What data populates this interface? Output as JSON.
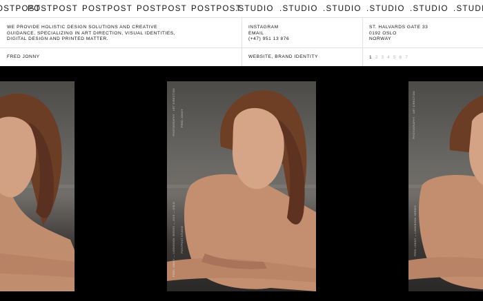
{
  "ticker": [
    "POSTPOST",
    "POSTPOST",
    "POSTPOST",
    "POSTPOST",
    ".STUDIO",
    ".STUDIO",
    ".STUDIO",
    ".STUDIO",
    ".STUDIO",
    ".STUDIO"
  ],
  "about": {
    "line1": "WE PROVIDE HOLISTIC DESIGN SOLUTIONS AND CREATIVE",
    "line2": "GUIDANCE, SPECIALIZING IN ART DIRECTION, VISUAL IDENTITIES,",
    "line3": "DIGITAL DESIGN AND PRINTED MATTER."
  },
  "contact": {
    "instagram": "INSTAGRAM",
    "email": "EMAIL",
    "phone": "(+47) 951 13 876"
  },
  "address": {
    "street": "ST. HALVARDS GATE 33",
    "postal": "0192 OSLO",
    "country": "NORWAY"
  },
  "project": {
    "client": "FRED JONNY",
    "services": "WEBSITE, BRAND IDENTITY"
  },
  "pagination": {
    "pages": [
      "1",
      "2",
      "3",
      "4",
      "5",
      "6",
      "7"
    ],
    "current": "1"
  },
  "colors": {
    "background": "#000000",
    "panel": "#ffffff",
    "text": "#111111",
    "inactive_page": "#b9b9b9"
  }
}
